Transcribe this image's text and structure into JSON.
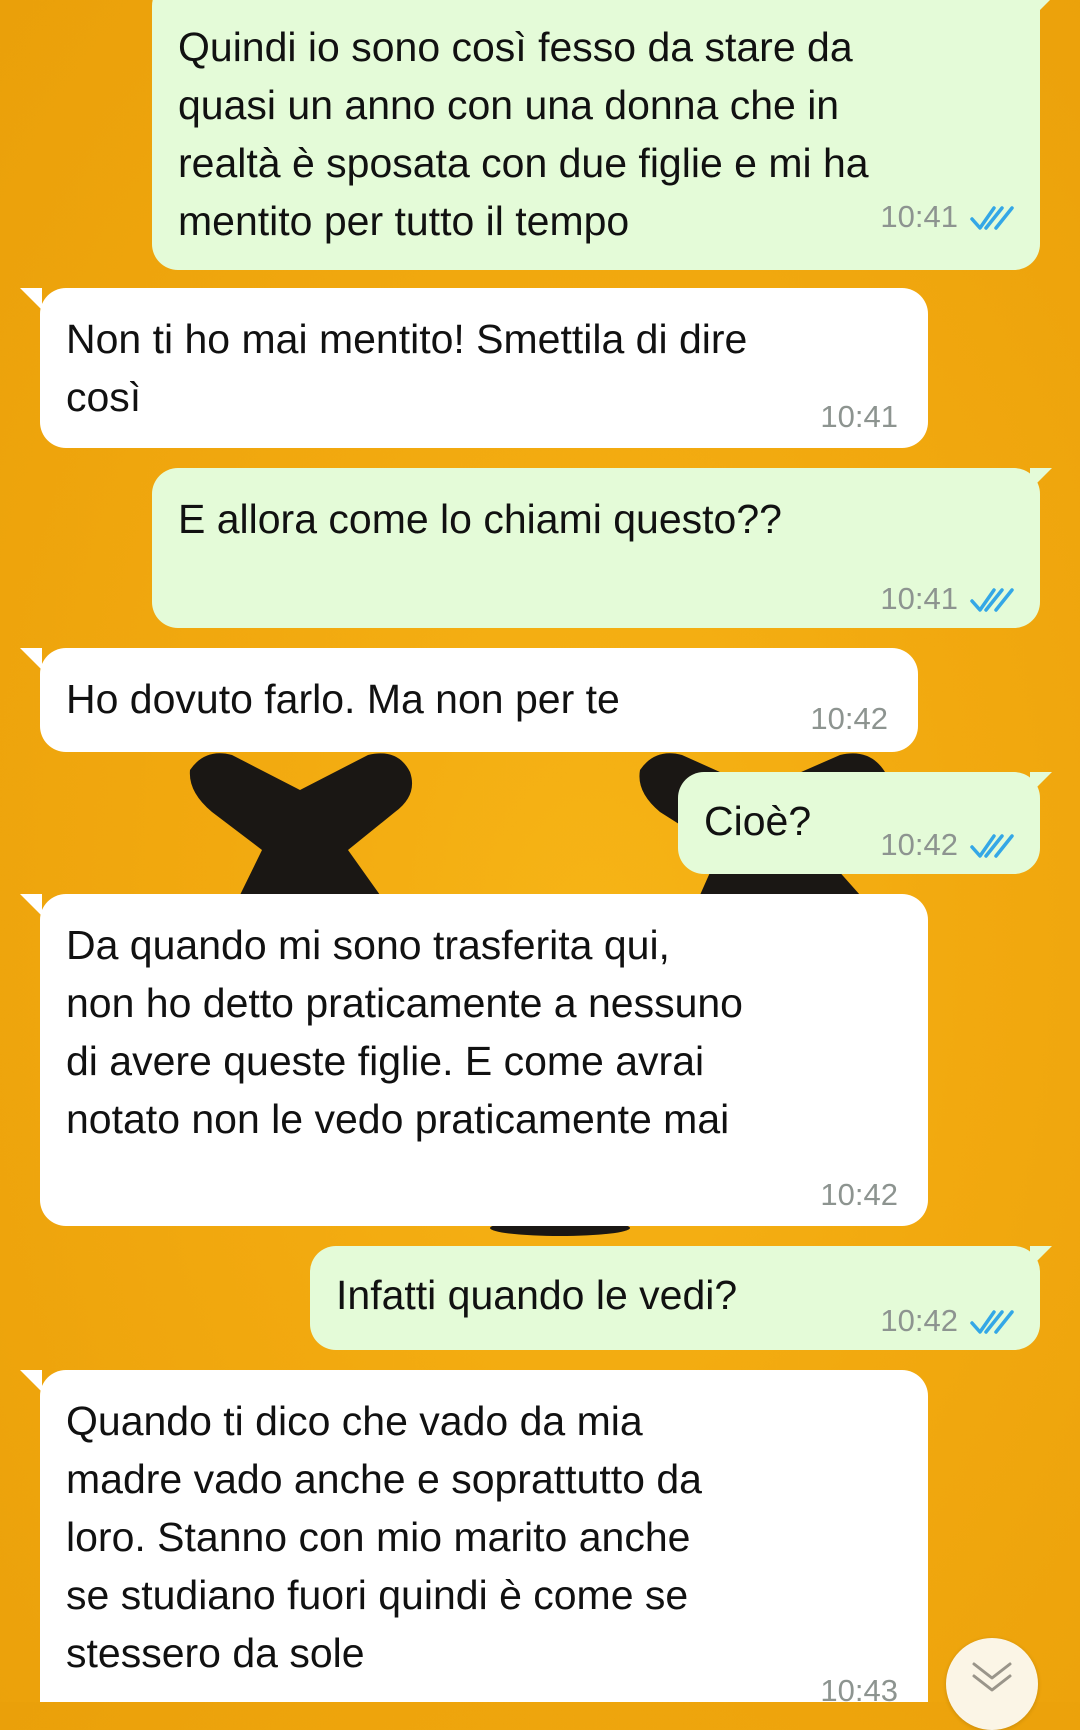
{
  "theme": {
    "outgoing_bubble": "#e4fbd8",
    "incoming_bubble": "#ffffff",
    "read_ticks": "#34a7e6",
    "wallpaper": "#f2a90f"
  },
  "messages": [
    {
      "direction": "out",
      "text": "Quindi io sono così fesso da stare da\nquasi un anno con una donna che in\nrealtà è sposata con due figlie e mi ha\nmentito per tutto il tempo",
      "time": "10:41",
      "status": "read-ticks-icon"
    },
    {
      "direction": "in",
      "text": "Non ti ho mai mentito! Smettila di dire\ncosì",
      "time": "10:41"
    },
    {
      "direction": "out",
      "text": "E allora come lo chiami questo??",
      "time": "10:41",
      "status": "read-ticks-icon"
    },
    {
      "direction": "in",
      "text": "Ho dovuto farlo. Ma non per te",
      "time": "10:42"
    },
    {
      "direction": "out",
      "text": "Cioè?",
      "time": "10:42",
      "status": "read-ticks-icon"
    },
    {
      "direction": "in",
      "text": "Da quando mi sono trasferita qui,\nnon ho detto praticamente a nessuno\ndi avere queste figlie. E come avrai\nnotato non le vedo praticamente mai",
      "time": "10:42"
    },
    {
      "direction": "out",
      "text": "Infatti quando le vedi?",
      "time": "10:42",
      "status": "read-ticks-icon"
    },
    {
      "direction": "in",
      "text": "Quando ti dico che vado da mia\nmadre vado anche e soprattutto da\nloro. Stanno con mio marito anche\nse studiano fuori quindi è come se\nstessero da sole",
      "time": "10:43"
    }
  ],
  "scroll_button": {
    "icon": "chevron-double-down-icon"
  }
}
